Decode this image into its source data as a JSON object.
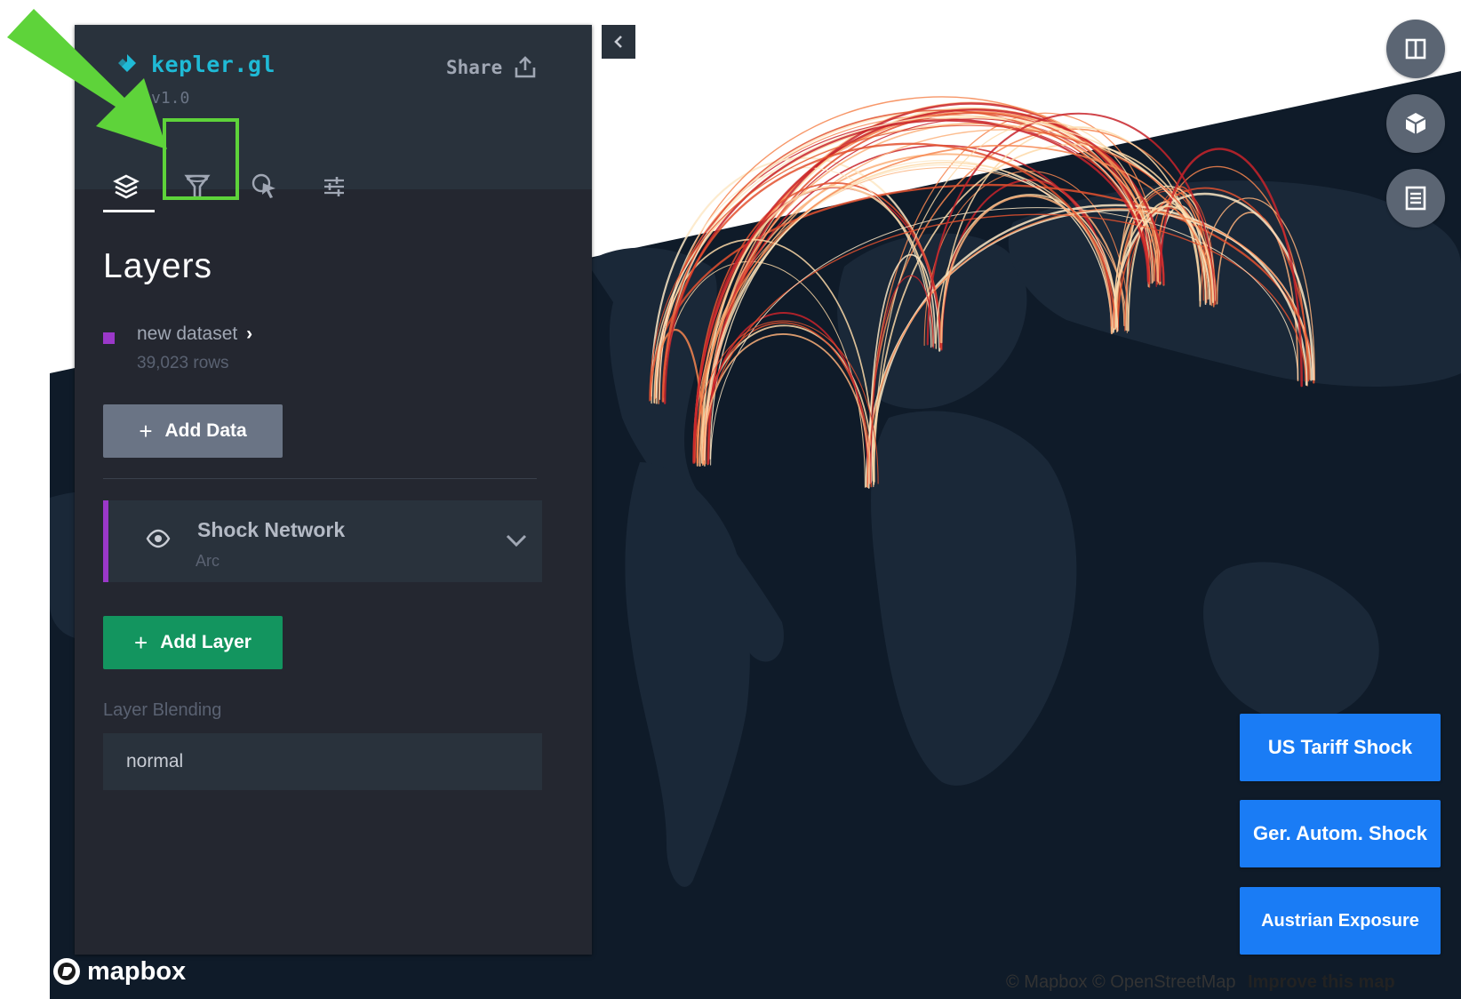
{
  "app": {
    "name": "kepler.gl",
    "version": "v1.0",
    "share_label": "Share"
  },
  "tabs": [
    {
      "icon": "layers-icon",
      "active": true
    },
    {
      "icon": "filter-icon",
      "active": false,
      "highlighted": true
    },
    {
      "icon": "interaction-icon",
      "active": false
    },
    {
      "icon": "map-settings-icon",
      "active": false
    }
  ],
  "panel": {
    "title": "Layers",
    "dataset": {
      "name": "new dataset",
      "rows": "39,023 rows",
      "color": "#9b38c9"
    },
    "add_data_label": "Add Data",
    "layer": {
      "name": "Shock Network",
      "type": "Arc",
      "color": "#9b38c9"
    },
    "add_layer_label": "Add Layer",
    "blending_label": "Layer Blending",
    "blending_value": "normal"
  },
  "map_controls": [
    "split-map-icon",
    "3d-view-icon",
    "legend-icon"
  ],
  "shock_buttons": [
    {
      "label": "US Tariff Shock"
    },
    {
      "label": "Ger. Autom. Shock"
    },
    {
      "label": "Austrian Exposure"
    }
  ],
  "map": {
    "logo_text": "mapbox",
    "attribution": "© Mapbox © OpenStreetMap",
    "improve_link": "Improve this map"
  },
  "colors": {
    "accent": "#1fbad6",
    "panel_bg": "#242730",
    "add_layer_green": "#13955f",
    "action_blue": "#1a7cf5",
    "annotation_green": "#5ed33a"
  }
}
